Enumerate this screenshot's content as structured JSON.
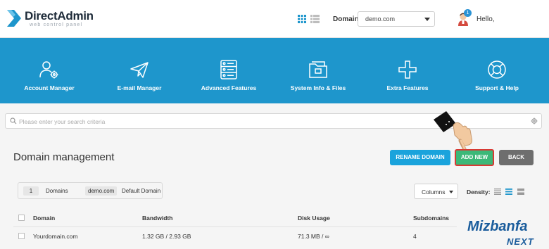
{
  "header": {
    "logo_title": "DirectAdmin",
    "logo_subtitle": "web control panel",
    "domain_label": "Domain",
    "domain_value": "demo.com",
    "notification_count": "1",
    "greeting": "Hello,"
  },
  "nav": {
    "items": [
      {
        "label": "Account Manager",
        "icon": "users-gear-icon"
      },
      {
        "label": "E-mail Manager",
        "icon": "paper-plane-icon"
      },
      {
        "label": "Advanced Features",
        "icon": "database-icon"
      },
      {
        "label": "System Info & Files",
        "icon": "folder-icon"
      },
      {
        "label": "Extra Features",
        "icon": "plus-icon"
      },
      {
        "label": "Support & Help",
        "icon": "lifebuoy-icon"
      }
    ],
    "background": "#1e96cc"
  },
  "search": {
    "placeholder": "Please enter your search criteria"
  },
  "page": {
    "title": "Domain management",
    "rename_button": "RENAME DOMAIN",
    "add_button": "ADD NEW",
    "back_button": "BACK"
  },
  "filter": {
    "count": "1",
    "count_label": "Domains",
    "default_domain": "demo.com",
    "default_label": "Default Domain"
  },
  "controls": {
    "columns_label": "Columns",
    "density_label": "Density:"
  },
  "table": {
    "headers": [
      "Domain",
      "Bandwidth",
      "Disk Usage",
      "Subdomains"
    ],
    "rows": [
      [
        "Yourdomain.com",
        "1.32 GB / 2.93 GB",
        "71.3 MB / ∞",
        "4"
      ]
    ]
  },
  "watermark": {
    "name": "Mizbanfa",
    "suffix": "NEXT"
  },
  "colors": {
    "accent": "#1e96cc",
    "rename": "#1aa3dc",
    "add": "#3cb878",
    "add_highlight": "#d83a34",
    "back": "#6e6e6e"
  }
}
